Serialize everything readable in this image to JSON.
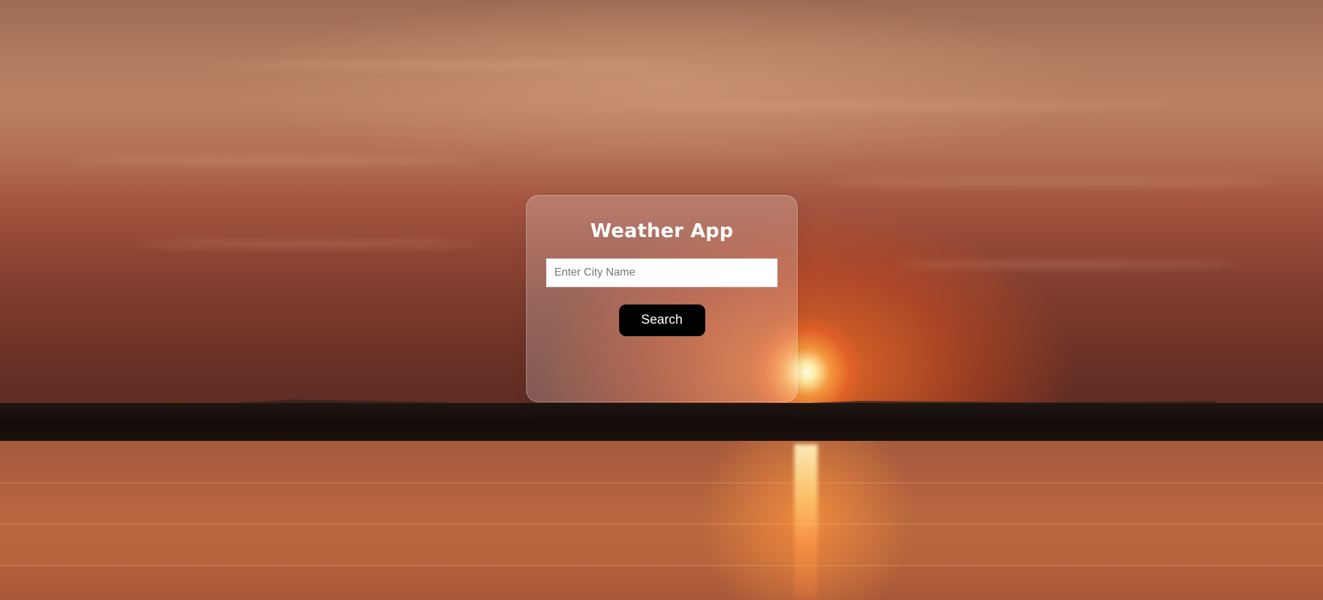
{
  "app": {
    "title": "Weather App"
  },
  "search": {
    "placeholder": "Enter City Name",
    "value": "",
    "button_label": "Search"
  },
  "theme": {
    "card_background": "rgba(255,255,255,0.22)",
    "button_color": "#000000",
    "button_text_color": "#ffffff",
    "title_color": "#ffffff"
  },
  "background": {
    "scene": "sunset-over-lake-image"
  }
}
